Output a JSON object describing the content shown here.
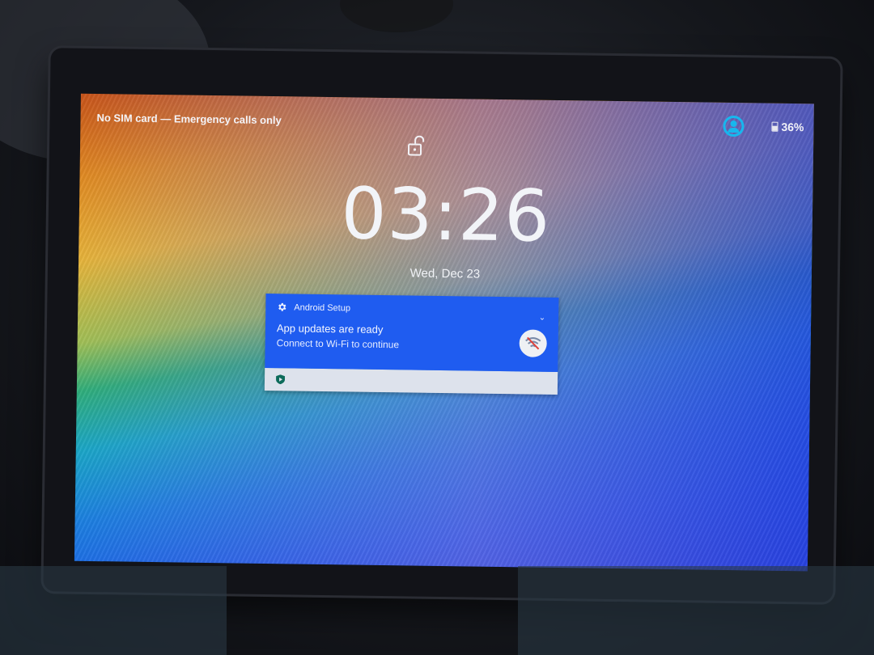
{
  "status_bar": {
    "carrier_text": "No SIM card — Emergency calls only",
    "battery_percent": "36%",
    "icons": [
      "user-icon",
      "battery-icon"
    ],
    "accent_color": "#17b7ee"
  },
  "lock_screen": {
    "lock_icon": "unlocked-padlock-icon",
    "time": "03:26",
    "date": "Wed, Dec 23"
  },
  "notification": {
    "app_name": "Android Setup",
    "app_icon": "gear-icon",
    "title": "App updates are ready",
    "text": "Connect to Wi-Fi to continue",
    "action_icon": "wifi-off-icon",
    "footer_icon": "play-protect-shield-icon",
    "background_color": "#1f5cf0",
    "footer_color": "#dde2ec"
  }
}
